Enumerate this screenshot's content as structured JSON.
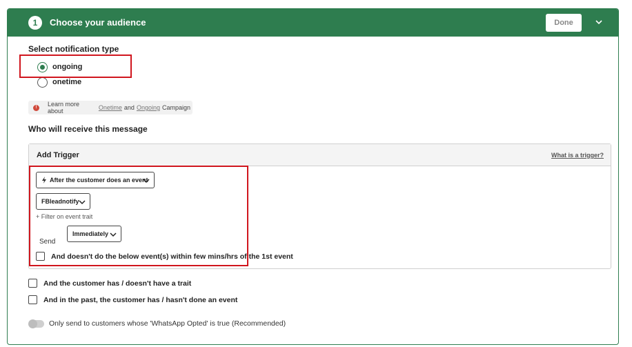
{
  "header": {
    "step_number": "1",
    "title": "Choose your audience",
    "done_label": "Done"
  },
  "notification": {
    "section_label": "Select notification type",
    "options": [
      {
        "label": "ongoing",
        "selected": true
      },
      {
        "label": "onetime",
        "selected": false
      }
    ]
  },
  "info": {
    "prefix": "Learn more about",
    "link_onetime": "Onetime",
    "and": "and",
    "link_ongoing": "Ongoing",
    "suffix": "Campaign"
  },
  "receive": {
    "section_label": "Who will receive this message"
  },
  "trigger": {
    "title": "Add Trigger",
    "help_link": "What is a trigger?",
    "event_type_value": "After the customer does an event",
    "event_value": "FBleadnotify",
    "filter_link": "+ Filter on event trait",
    "send_label": "Send",
    "send_value": "Immediately",
    "negative_event_label": "And doesn't do the below event(s) within few mins/hrs of the 1st event"
  },
  "conditions": {
    "trait_label": "And the customer has / doesn't have a trait",
    "past_event_label": "And in the past, the customer has / hasn't done an event"
  },
  "optin": {
    "label": "Only send to customers whose 'WhatsApp Opted' is true (Recommended)",
    "enabled": false
  },
  "colors": {
    "brand_green": "#2e7d4f",
    "highlight_red": "#d0151d"
  }
}
